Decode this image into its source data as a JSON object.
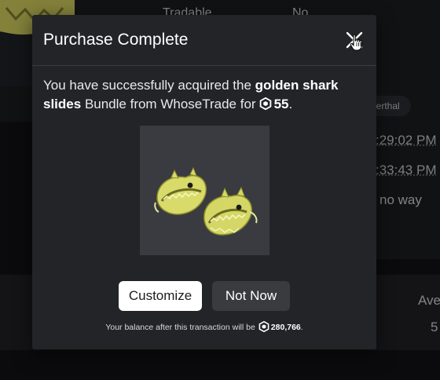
{
  "background": {
    "tradable_label": "Tradable",
    "tradable_value": "No",
    "owner_chip": "derthal",
    "time_1": ":29:02 PM",
    "time_2": ":33:43 PM",
    "side_text": "no way",
    "stat_label": "Ave",
    "stat_value": "5"
  },
  "modal": {
    "title": "Purchase Complete",
    "message_prefix": "You have successfully acquired the",
    "item_name": "golden shark slides",
    "message_middle": "Bundle from WhoseTrade for",
    "price": "55",
    "customize_label": "Customize",
    "not_now_label": "Not Now",
    "balance_prefix": "Your balance after this transaction will be",
    "balance_amount": "280,766",
    "balance_suffix": "."
  },
  "icons": {
    "close": "close-icon",
    "currency": "robux-icon",
    "cursor": "hand-pointer-icon"
  },
  "colors": {
    "modal_bg": "#232428",
    "primary_button": "#ffffff",
    "secondary_button": "#393b3f",
    "item_yellow": "#dde07a"
  }
}
